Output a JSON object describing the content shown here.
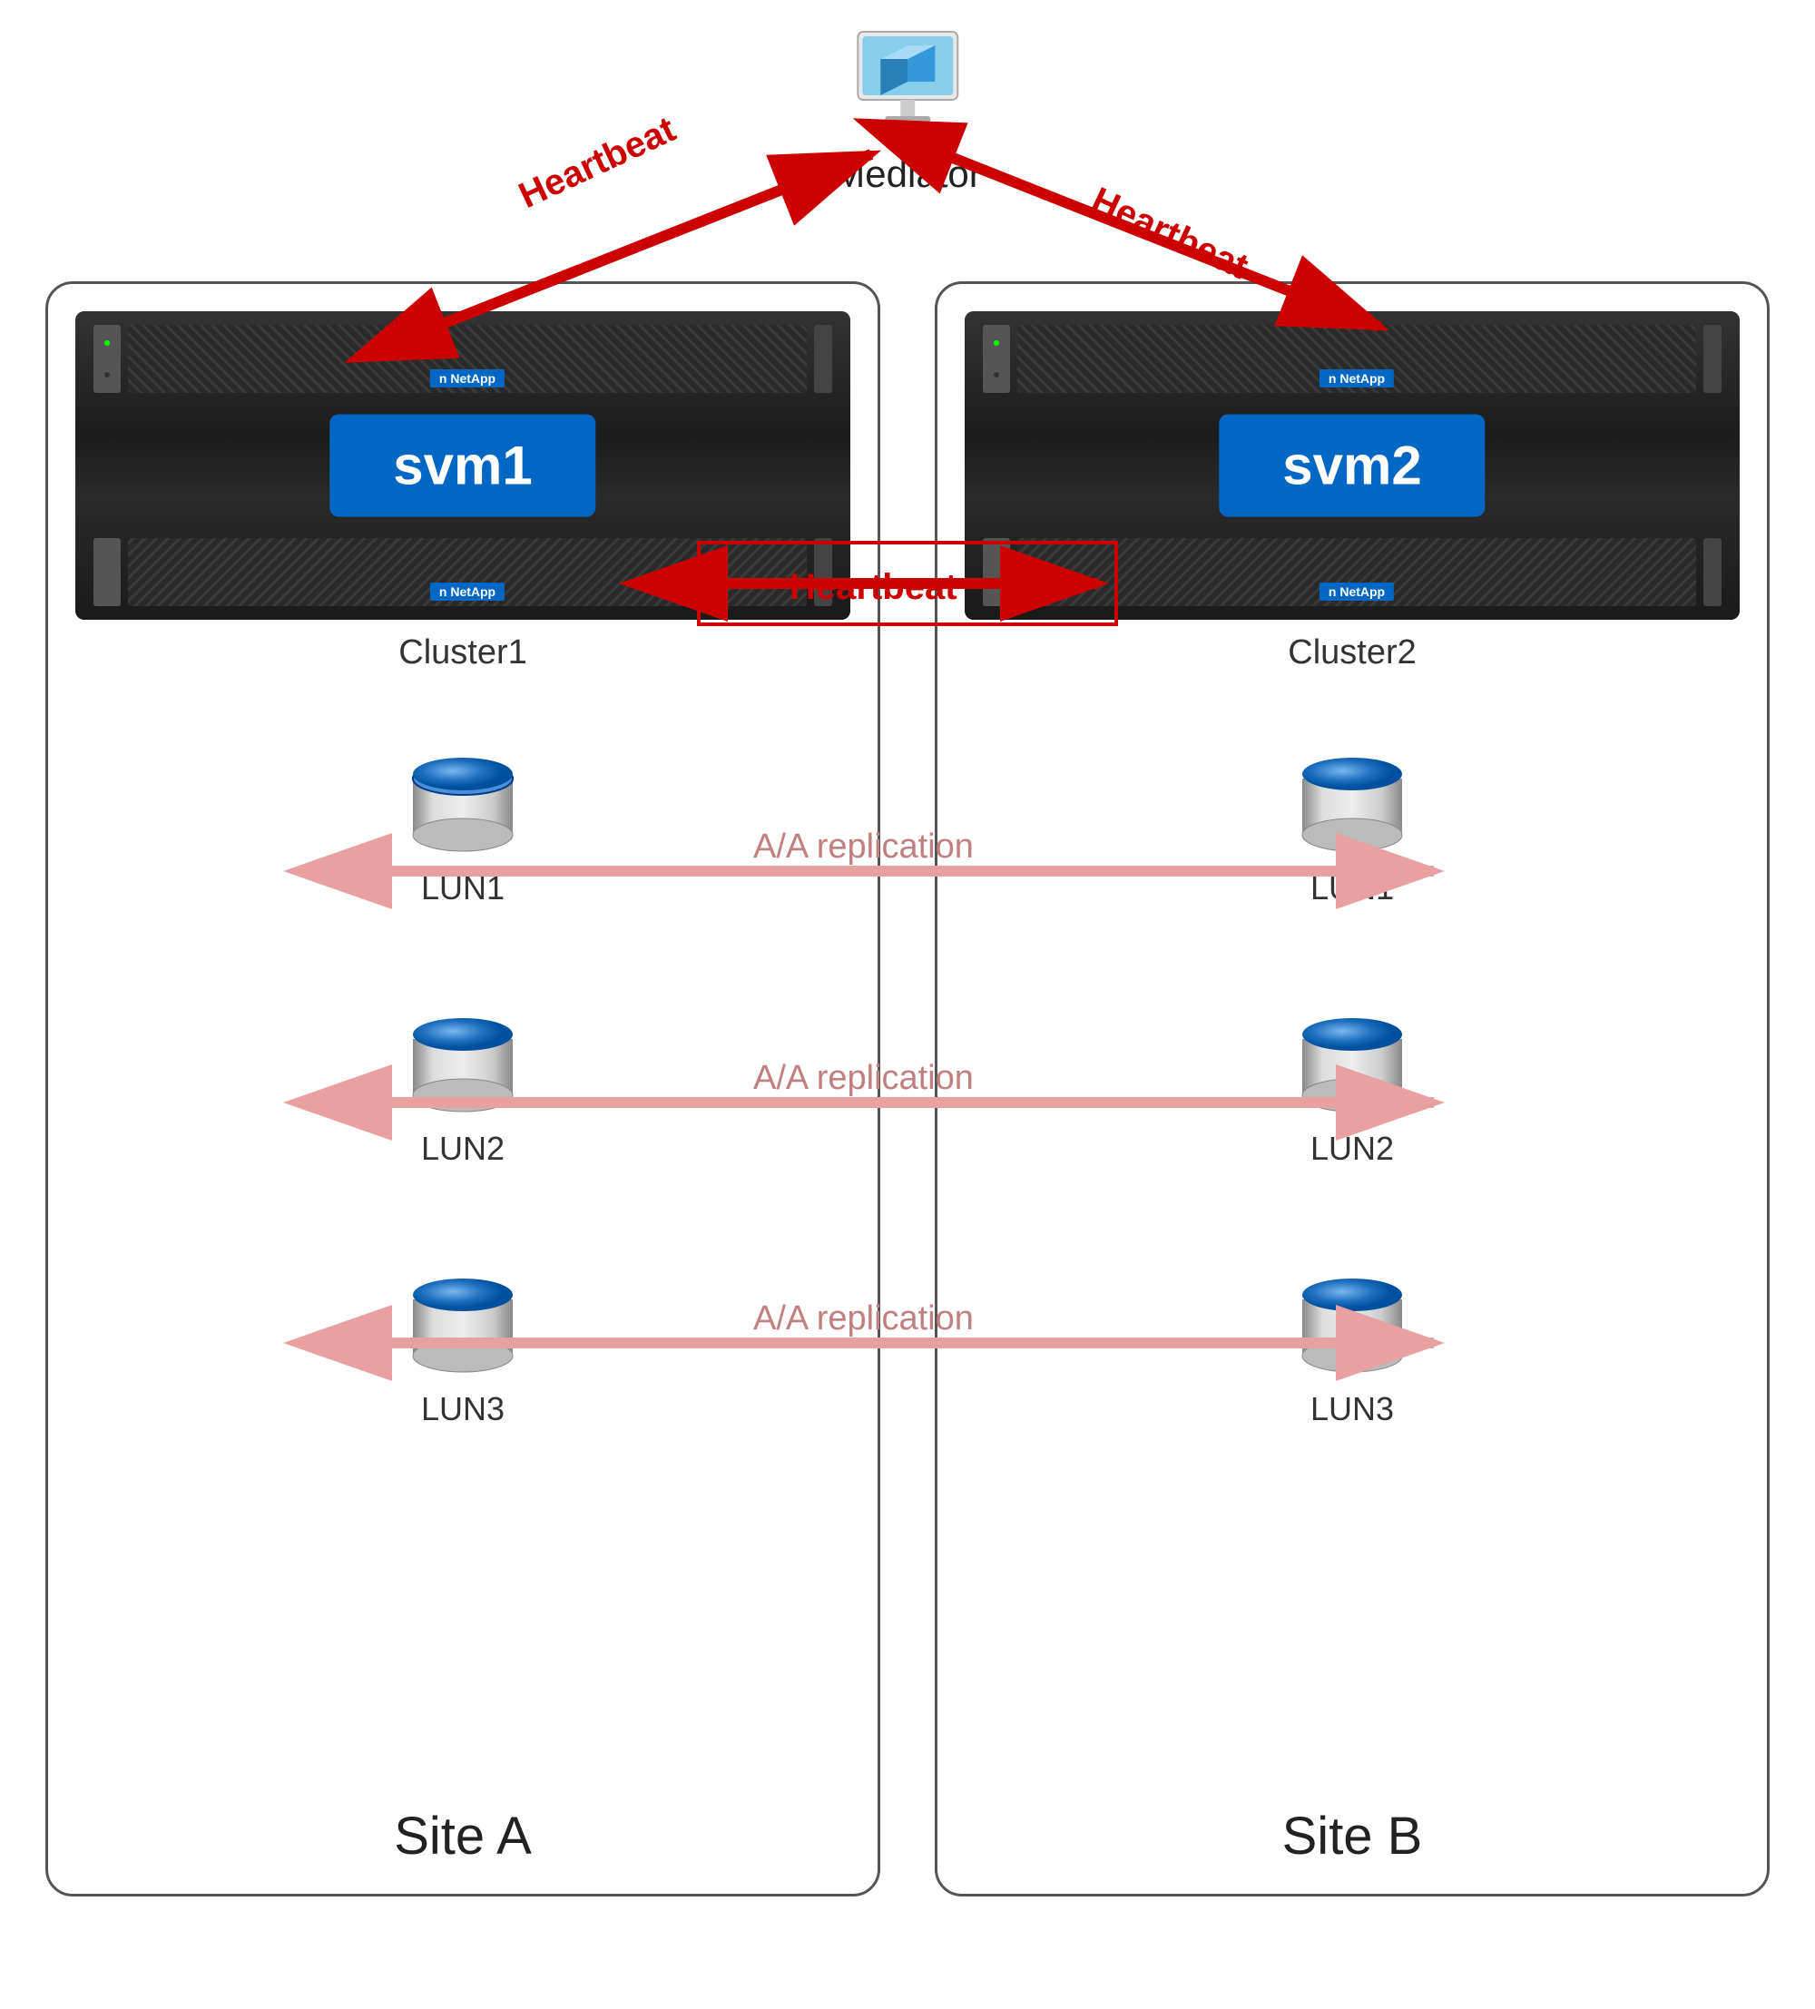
{
  "mediator": {
    "label": "Mediator"
  },
  "site_a": {
    "label": "Site A",
    "cluster": {
      "label": "Cluster1",
      "svm": "svm1"
    },
    "luns": [
      "LUN1",
      "LUN2",
      "LUN3"
    ]
  },
  "site_b": {
    "label": "Site B",
    "cluster": {
      "label": "Cluster2",
      "svm": "svm2"
    },
    "luns": [
      "LUN1",
      "LUN2",
      "LUN3"
    ]
  },
  "arrows": {
    "heartbeat_label": "Heartbeat",
    "replication_label": "A/A replication"
  },
  "colors": {
    "red_arrow": "#cc0000",
    "pink_arrow": "#e8a0a0",
    "blue_svm": "#0067C5",
    "border": "#555555"
  }
}
